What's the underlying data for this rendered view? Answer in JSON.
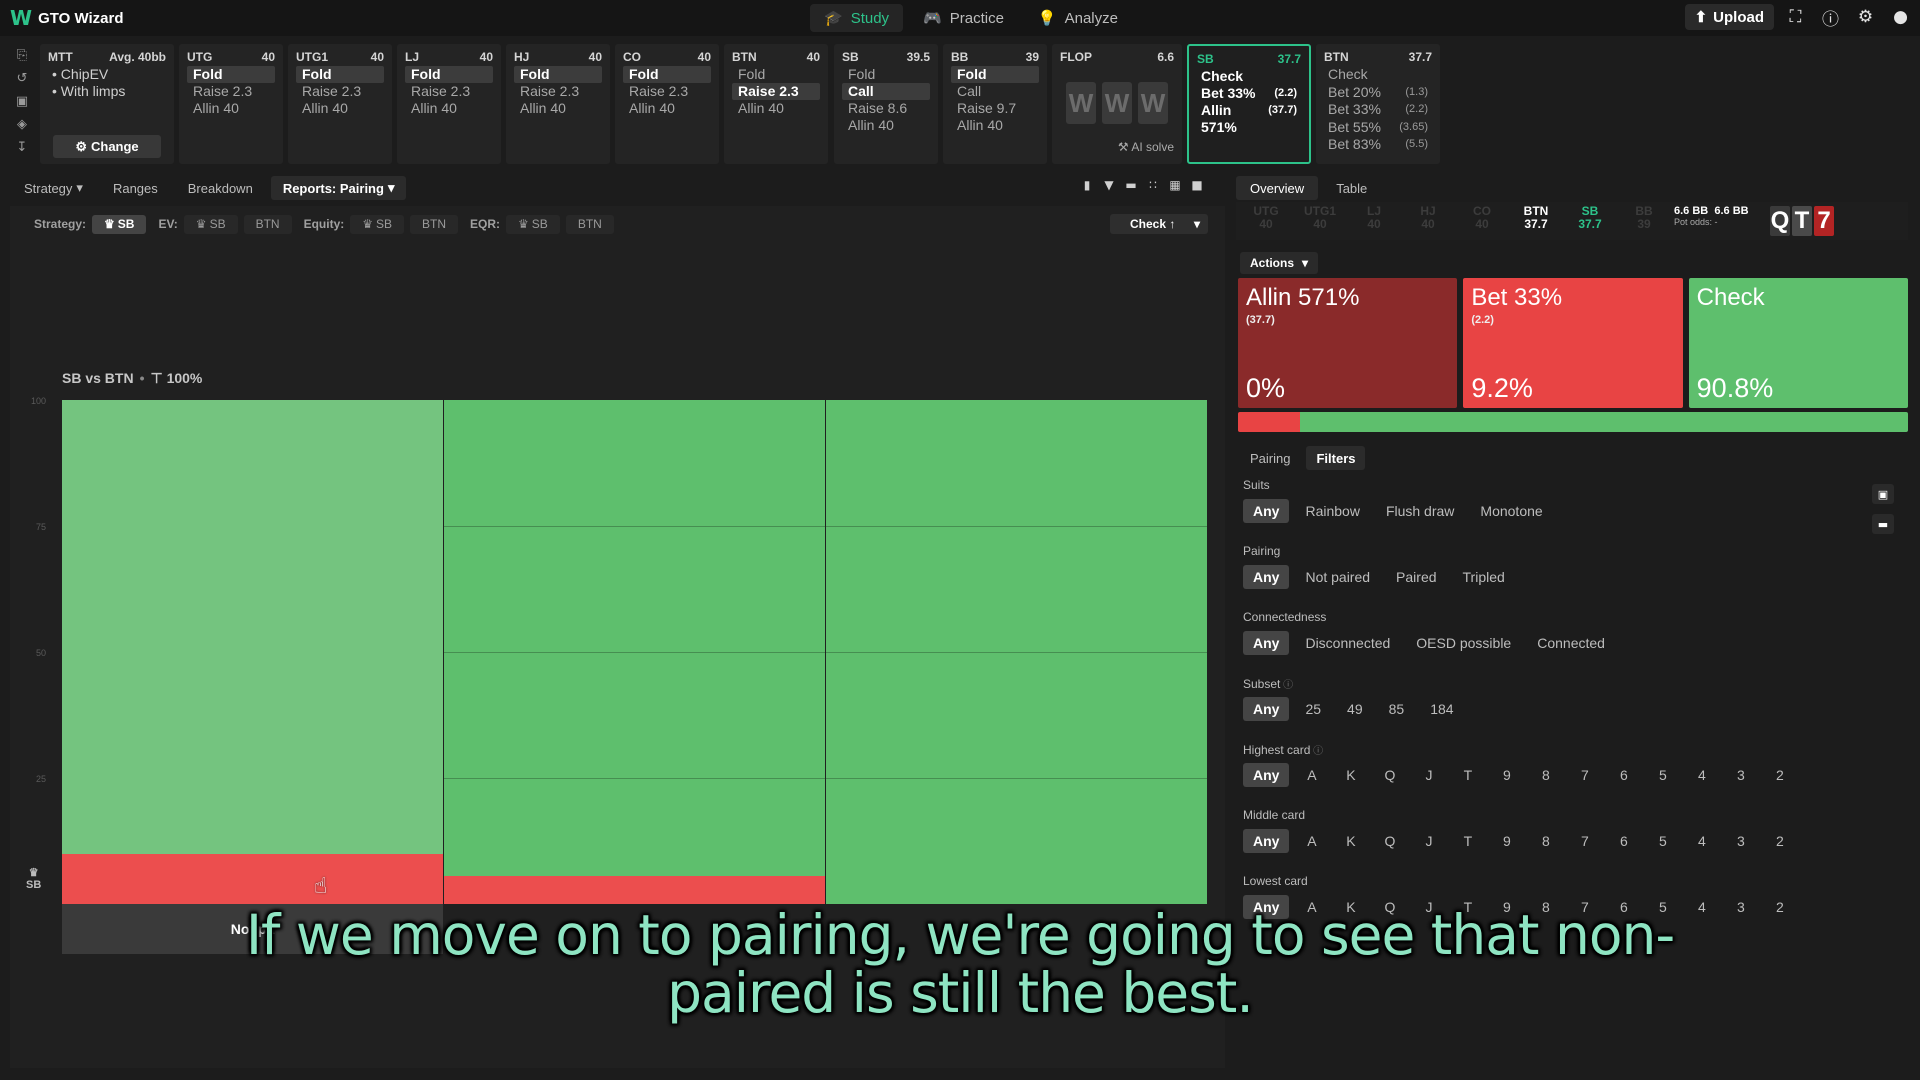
{
  "app": {
    "logo_mark": "W",
    "title": "GTO Wizard"
  },
  "nav": [
    {
      "label": "Study",
      "icon": "graduation-cap-icon",
      "glyph": "🎓"
    },
    {
      "label": "Practice",
      "icon": "gamepad-icon",
      "glyph": "🎮"
    },
    {
      "label": "Analyze",
      "icon": "lightbulb-icon",
      "glyph": "💡"
    }
  ],
  "topright": {
    "upload_label": "Upload"
  },
  "strip": {
    "mtt": {
      "title": "MTT",
      "avg": "Avg. 40bb",
      "line1": "• ChipEV",
      "line2": "• With limps",
      "change_label": "Change"
    },
    "positions": [
      {
        "name": "UTG",
        "stack": "40",
        "fold": "Fold",
        "raise": "Raise 2.3",
        "allin": "Allin 40"
      },
      {
        "name": "UTG1",
        "stack": "40",
        "fold": "Fold",
        "raise": "Raise 2.3",
        "allin": "Allin 40"
      },
      {
        "name": "LJ",
        "stack": "40",
        "fold": "Fold",
        "raise": "Raise 2.3",
        "allin": "Allin 40"
      },
      {
        "name": "HJ",
        "stack": "40",
        "fold": "Fold",
        "raise": "Raise 2.3",
        "allin": "Allin 40"
      },
      {
        "name": "CO",
        "stack": "40",
        "fold": "Fold",
        "raise": "Raise 2.3",
        "allin": "Allin 40"
      },
      {
        "name": "BTN",
        "stack": "40",
        "fold": "Fold",
        "raise": "Raise 2.3",
        "allin": "Allin 40"
      }
    ],
    "sb": {
      "name": "SB",
      "stack": "39.5",
      "l1": "Fold",
      "l2": "Call",
      "l3": "Raise 8.6",
      "l4": "Allin 40"
    },
    "bb": {
      "name": "BB",
      "stack": "39",
      "l1": "Fold",
      "l2": "Call",
      "l3": "Raise 9.7",
      "l4": "Allin 40"
    },
    "flop": {
      "name": "FLOP",
      "pot": "6.6",
      "cards": [
        "W",
        "W",
        "W"
      ],
      "ai_solve": "AI solve"
    },
    "sb_active": {
      "name": "SB",
      "stack": "37.7",
      "check": "Check",
      "bet": "Bet 33%",
      "bet_size": "(2.2)",
      "allin": "Allin 571%",
      "allin_size": "(37.7)"
    },
    "btn_next": {
      "name": "BTN",
      "stack": "37.7",
      "lines": [
        {
          "label": "Check",
          "size": ""
        },
        {
          "label": "Bet 20%",
          "size": "(1.3)"
        },
        {
          "label": "Bet 33%",
          "size": "(2.2)"
        },
        {
          "label": "Bet 55%",
          "size": "(3.65)"
        },
        {
          "label": "Bet 83%",
          "size": "(5.5)"
        }
      ]
    }
  },
  "left_tabs": [
    {
      "label": "Strategy",
      "dropdown": true
    },
    {
      "label": "Ranges",
      "dropdown": false
    },
    {
      "label": "Breakdown",
      "dropdown": false
    },
    {
      "label": "Reports: Pairing",
      "dropdown": true
    }
  ],
  "filters": {
    "strategy_label": "Strategy:",
    "strategy_sb": "SB",
    "ev_label": "EV:",
    "ev_sb": "SB",
    "ev_btn": "BTN",
    "equity_label": "Equity:",
    "equity_sb": "SB",
    "equity_btn": "BTN",
    "eqr_label": "EQR:",
    "eqr_sb": "SB",
    "eqr_btn": "BTN",
    "check_dropdown": "Check ↑"
  },
  "report": {
    "title": "SB vs BTN",
    "filter_pct": "100%",
    "player_label": "SB",
    "y_ticks": [
      "100",
      "75",
      "50",
      "25"
    ]
  },
  "chart_data": {
    "type": "bar",
    "stacked": true,
    "categories": [
      "Not pa",
      "Paired",
      "Tripled"
    ],
    "series": [
      {
        "name": "Bet",
        "color": "#ec4e4e",
        "values": [
          10,
          5.5,
          0
        ]
      },
      {
        "name": "Check",
        "color": "#5ebf6d",
        "values": [
          90,
          94.5,
          100
        ]
      }
    ],
    "ylim": [
      0,
      100
    ],
    "grid": true
  },
  "right": {
    "tabs": [
      "Overview",
      "Table"
    ],
    "players": [
      {
        "name": "UTG",
        "stack": "40"
      },
      {
        "name": "UTG1",
        "stack": "40"
      },
      {
        "name": "LJ",
        "stack": "40"
      },
      {
        "name": "HJ",
        "stack": "40"
      },
      {
        "name": "CO",
        "stack": "40"
      },
      {
        "name": "BTN",
        "stack": "37.7"
      },
      {
        "name": "SB",
        "stack": "37.7"
      },
      {
        "name": "BB",
        "stack": "39"
      }
    ],
    "pot": {
      "a": "6.6 BB",
      "b": "6.6 BB",
      "odds": "Pot odds: -"
    },
    "board": [
      "Q",
      "T",
      "7"
    ],
    "actions_label": "Actions",
    "actions": [
      {
        "name": "Allin 571%",
        "size": "(37.7)",
        "pct": "0%",
        "color": "#8a2a2a"
      },
      {
        "name": "Bet 33%",
        "size": "(2.2)",
        "pct": "9.2%",
        "color": "#e84444"
      },
      {
        "name": "Check",
        "size": "",
        "pct": "90.8%",
        "color": "#5ebf6d"
      }
    ],
    "freq": {
      "bet": 9.2,
      "check": 90.8
    },
    "panel_tabs": [
      "Pairing",
      "Filters"
    ],
    "groups": [
      {
        "label": "Suits",
        "opts": [
          "Any",
          "Rainbow",
          "Flush draw",
          "Monotone"
        ]
      },
      {
        "label": "Pairing",
        "opts": [
          "Any",
          "Not paired",
          "Paired",
          "Tripled"
        ]
      },
      {
        "label": "Connectedness",
        "opts": [
          "Any",
          "Disconnected",
          "OESD possible",
          "Connected"
        ]
      },
      {
        "label": "Subset",
        "opts": [
          "Any",
          "25",
          "49",
          "85",
          "184"
        ]
      },
      {
        "label": "Highest card",
        "opts": [
          "Any",
          "A",
          "K",
          "Q",
          "J",
          "T",
          "9",
          "8",
          "7",
          "6",
          "5",
          "4",
          "3",
          "2"
        ]
      },
      {
        "label": "Middle card",
        "opts": [
          "Any",
          "A",
          "K",
          "Q",
          "J",
          "T",
          "9",
          "8",
          "7",
          "6",
          "5",
          "4",
          "3",
          "2"
        ]
      },
      {
        "label": "Lowest card",
        "opts": [
          "Any",
          "A",
          "K",
          "Q",
          "J",
          "T",
          "9",
          "8",
          "7",
          "6",
          "5",
          "4",
          "3",
          "2"
        ]
      }
    ]
  },
  "subtitle": {
    "line1": "If we move on to pairing, we're going to see that non-",
    "line2": "paired is still the best."
  }
}
